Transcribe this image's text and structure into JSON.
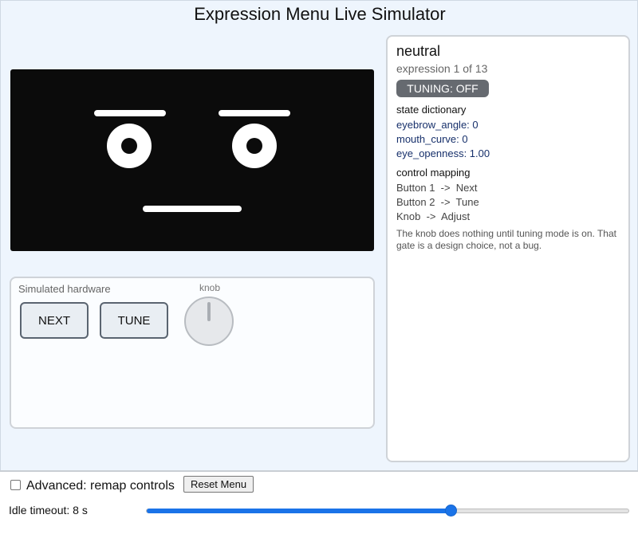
{
  "header": {
    "title": "Expression Menu Live Simulator"
  },
  "face": {
    "background": "#0b0b0b",
    "stroke": "#ffffff"
  },
  "hardware": {
    "label": "Simulated hardware",
    "next_label": "NEXT",
    "tune_label": "TUNE",
    "knob_label": "knob"
  },
  "info": {
    "expression_name": "neutral",
    "expression_count": "expression 1 of 13",
    "tuning_badge": "TUNING: OFF",
    "state_heading": "state dictionary",
    "state": [
      "eyebrow_angle: 0",
      "mouth_curve: 0",
      "eye_openness: 1.00"
    ],
    "mapping_heading": "control mapping",
    "mapping": [
      "Button 1  ->  Next",
      "Button 2  ->  Tune",
      "Knob  ->  Adjust"
    ],
    "note": "The knob does nothing until tuning mode is on. That gate is a design choice, not a bug."
  },
  "footer": {
    "advanced_label": "Advanced: remap controls",
    "advanced_checked": false,
    "reset_label": "Reset Menu",
    "idle_label": "Idle timeout: 8 s",
    "idle_slider_fraction": 0.63
  },
  "colors": {
    "accent": "#1a73e8",
    "state_text": "#17306b",
    "badge": "#666a70"
  }
}
